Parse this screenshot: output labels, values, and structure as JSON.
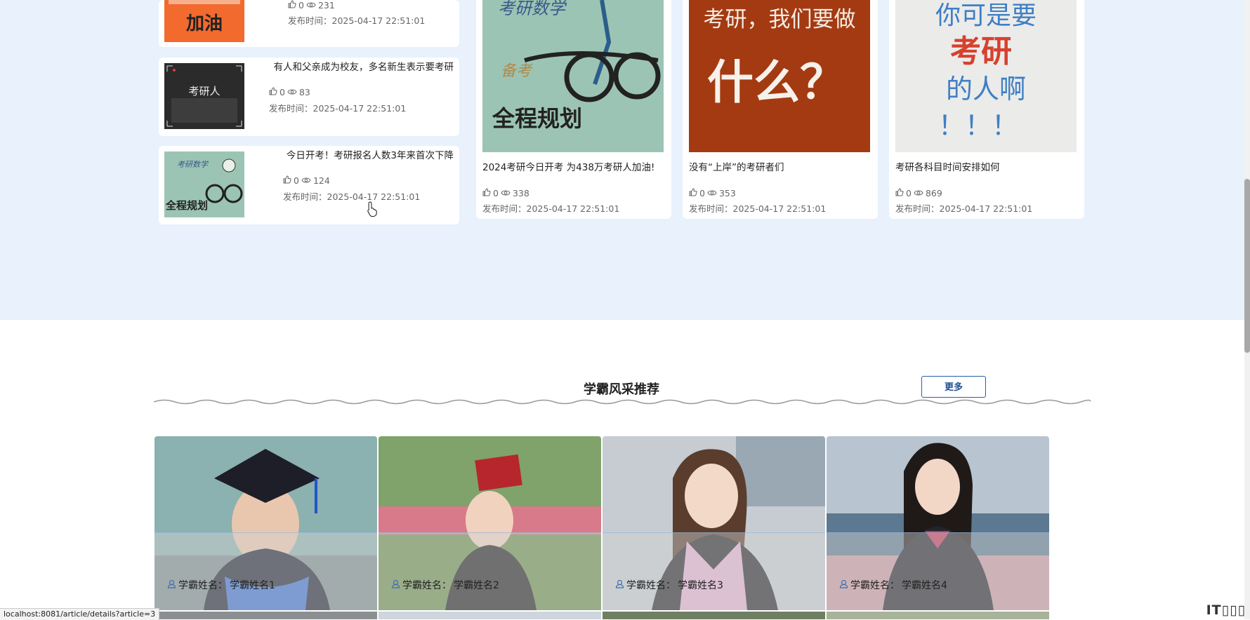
{
  "articles_list": [
    {
      "title": "",
      "likes": "0",
      "views": "231",
      "time_label": "发布时间：",
      "time": "2025-04-17 22:51:01",
      "thumb_text": "加油"
    },
    {
      "title": "有人和父亲成为校友，多名新生表示要考研",
      "likes": "0",
      "views": "83",
      "time_label": "发布时间：",
      "time": "2025-04-17 22:51:01",
      "thumb_text": "考研人"
    },
    {
      "title": "今日开考！考研报名人数3年来首次下降",
      "likes": "0",
      "views": "124",
      "time_label": "发布时间：",
      "time": "2025-04-17 22:51:01",
      "thumb_text": "全程规划"
    }
  ],
  "articles_grid": [
    {
      "title": "2024考研今日开考 为438万考研人加油!",
      "likes": "0",
      "views": "338",
      "time_label": "发布时间：",
      "time": "2025-04-17 22:51:01",
      "img_text_a": "考研数学",
      "img_text_b": "备考",
      "img_text_c": "全程规划"
    },
    {
      "title": "没有“上岸”的考研者们",
      "likes": "0",
      "views": "353",
      "time_label": "发布时间：",
      "time": "2025-04-17 22:51:01",
      "img_text_a": "考研，我们要做",
      "img_text_b": "什么？"
    },
    {
      "title": "考研各科目时间安排如何",
      "likes": "0",
      "views": "869",
      "time_label": "发布时间：",
      "time": "2025-04-17 22:51:01",
      "img_text_a": "你可是要",
      "img_text_b": "考研",
      "img_text_c": "的人啊",
      "img_text_d": "！！！"
    }
  ],
  "scholar_section": {
    "title": "学霸风采推荐",
    "more_label": "更多",
    "items": [
      {
        "label": "学霸姓名：",
        "name": "学霸姓名1"
      },
      {
        "label": "学霸姓名：",
        "name": "学霸姓名2"
      },
      {
        "label": "学霸姓名：",
        "name": "学霸姓名3"
      },
      {
        "label": "学霸姓名：",
        "name": "学霸姓名4"
      }
    ]
  },
  "status_bar": {
    "url": "localhost:8081/article/details?article=3"
  },
  "watermark": "IT",
  "colors": {
    "band_bg": "#e8f1fc",
    "accent": "#2a5ea8"
  }
}
